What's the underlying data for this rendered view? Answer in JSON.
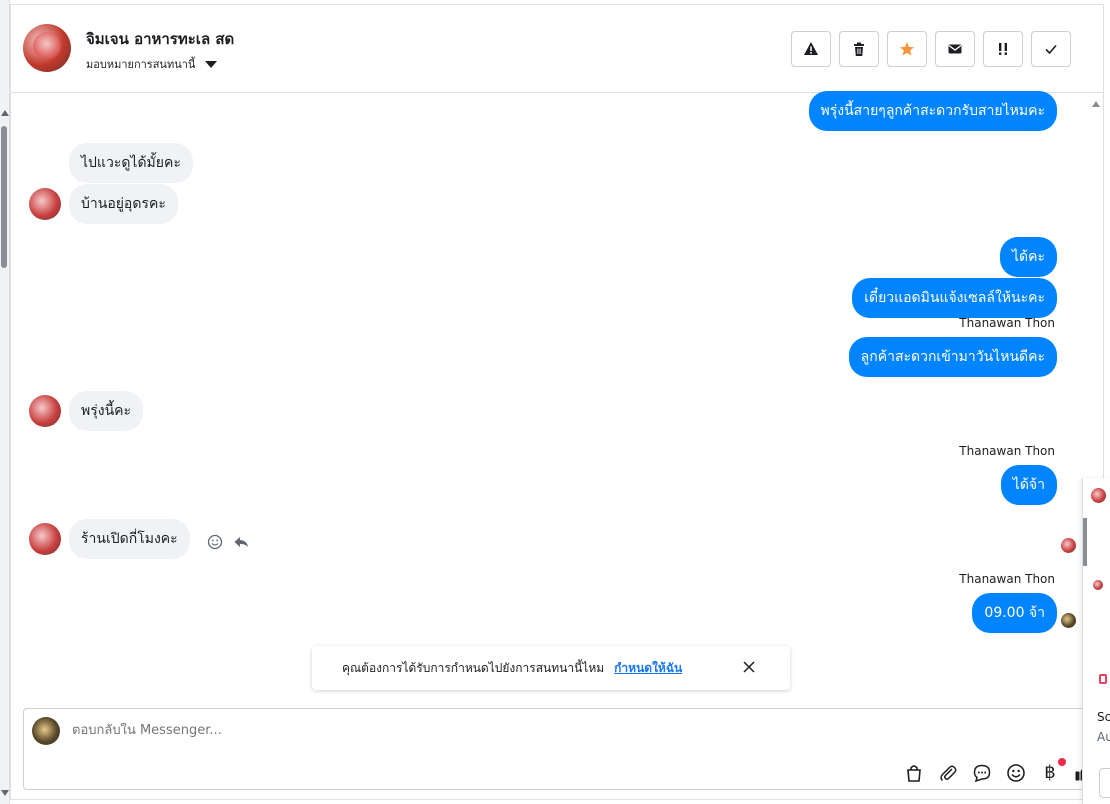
{
  "header": {
    "contact_name": "จิมเจน อาหารทะเล สด",
    "assign_label": "มอบหมายการสนทนานี้",
    "toolbar": [
      {
        "name": "warning-button",
        "icon": "warning-icon"
      },
      {
        "name": "delete-button",
        "icon": "trash-icon"
      },
      {
        "name": "star-button",
        "icon": "star-icon",
        "color": "#f7923b"
      },
      {
        "name": "mark-unread-button",
        "icon": "envelope-icon"
      },
      {
        "name": "priority-button",
        "icon": "exclamation-icon"
      },
      {
        "name": "done-button",
        "icon": "check-icon"
      }
    ]
  },
  "messages": [
    {
      "dir": "out",
      "text": "พรุ่งนี้สายๆลูกค้าสะดวกรับสายไหมคะ"
    },
    {
      "dir": "in",
      "text": "ไปแวะดูได้มั้ยคะ"
    },
    {
      "dir": "in",
      "text": "บ้านอยู่อุดรคะ"
    },
    {
      "dir": "out",
      "text": "ได้คะ"
    },
    {
      "dir": "out",
      "text": "เดี๋ยวแอดมินแจ้งเซลล์ให้นะคะ"
    },
    {
      "dir": "out",
      "sender": "Thanawan Thon",
      "text": "ลูกค้าสะดวกเข้ามาวันไหนดีคะ"
    },
    {
      "dir": "in",
      "text": "พรุ่งนี้คะ"
    },
    {
      "dir": "out",
      "sender": "Thanawan Thon",
      "text": "ได้จ้า"
    },
    {
      "dir": "in",
      "text": "ร้านเปิดกี่โมงคะ"
    },
    {
      "dir": "out",
      "sender": "Thanawan Thon",
      "text": "09.00 จ้า"
    }
  ],
  "notice": {
    "text": "คุณต้องการได้รับการกำหนดไปยังการสนทนานี้ไหม",
    "link": "กำหนดให้ฉัน"
  },
  "composer": {
    "placeholder": "ตอบกลับใน Messenger...",
    "tools": [
      "bag-icon",
      "paperclip-icon",
      "chat-bubble-icon",
      "emoji-icon",
      "baht-icon",
      "thumbs-up-icon"
    ],
    "baht_symbol": "฿"
  },
  "side_peek": {
    "text1": "Sc",
    "text2": "Au"
  },
  "colors": {
    "outgoing": "#0084ff",
    "incoming": "#f0f2f5",
    "link": "#1877f2"
  }
}
